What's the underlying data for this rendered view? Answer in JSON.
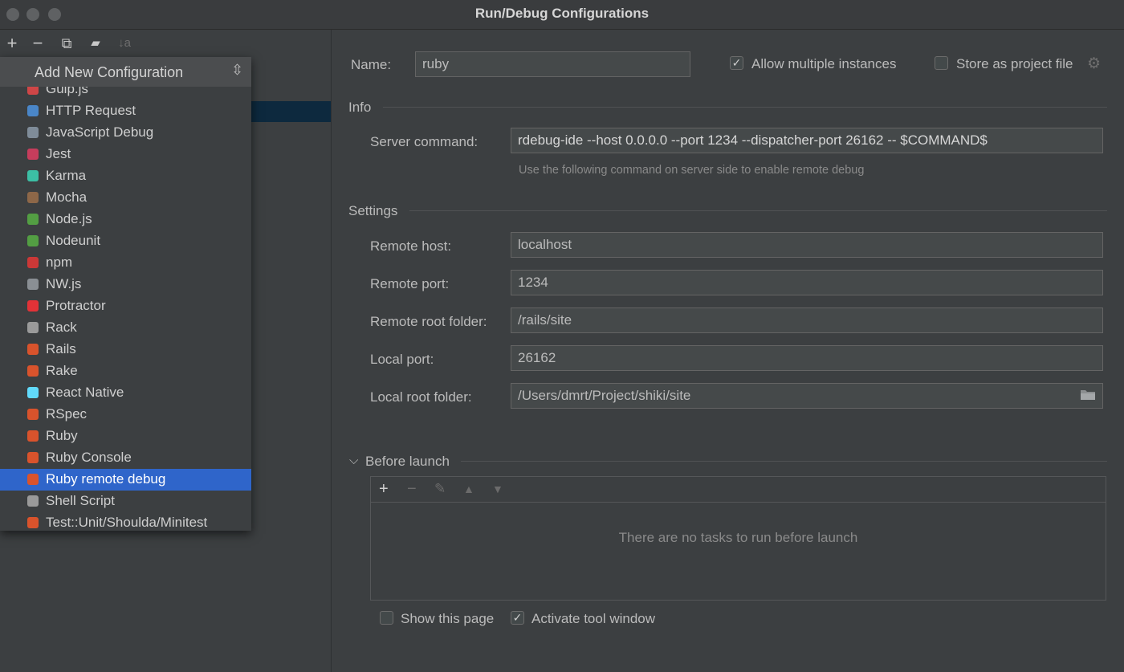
{
  "window": {
    "title": "Run/Debug Configurations"
  },
  "left_toolbar": {
    "add": "+",
    "remove": "−",
    "copy": "⧉",
    "folder": "▰",
    "sort": "↓a"
  },
  "popup": {
    "title": "Add New Configuration",
    "items": [
      {
        "label": "Gulp.js",
        "icon": "gulp-icon",
        "color": "#cf4647"
      },
      {
        "label": "HTTP Request",
        "icon": "api-icon",
        "color": "#4a86c8"
      },
      {
        "label": "JavaScript Debug",
        "icon": "js-debug-icon",
        "color": "#7f8c99"
      },
      {
        "label": "Jest",
        "icon": "jest-icon",
        "color": "#c63d5c"
      },
      {
        "label": "Karma",
        "icon": "karma-icon",
        "color": "#3cbfa5"
      },
      {
        "label": "Mocha",
        "icon": "mocha-icon",
        "color": "#8d6748"
      },
      {
        "label": "Node.js",
        "icon": "nodejs-icon",
        "color": "#539e43"
      },
      {
        "label": "Nodeunit",
        "icon": "nodeunit-icon",
        "color": "#539e43"
      },
      {
        "label": "npm",
        "icon": "npm-icon",
        "color": "#cb3837"
      },
      {
        "label": "NW.js",
        "icon": "nwjs-icon",
        "color": "#8a8f94"
      },
      {
        "label": "Protractor",
        "icon": "protractor-icon",
        "color": "#e23237"
      },
      {
        "label": "Rack",
        "icon": "rack-icon",
        "color": "#9a9a9a"
      },
      {
        "label": "Rails",
        "icon": "rails-icon",
        "color": "#d9532c"
      },
      {
        "label": "Rake",
        "icon": "rake-icon",
        "color": "#d9532c"
      },
      {
        "label": "React Native",
        "icon": "react-icon",
        "color": "#61dafb"
      },
      {
        "label": "RSpec",
        "icon": "rspec-icon",
        "color": "#d9532c"
      },
      {
        "label": "Ruby",
        "icon": "ruby-icon",
        "color": "#d9532c"
      },
      {
        "label": "Ruby Console",
        "icon": "ruby-console-icon",
        "color": "#d9532c"
      },
      {
        "label": "Ruby remote debug",
        "icon": "ruby-remote-debug-icon",
        "color": "#d9532c",
        "selected": true
      },
      {
        "label": "Shell Script",
        "icon": "shell-script-icon",
        "color": "#9a9a9a"
      },
      {
        "label": "Test::Unit/Shoulda/Minitest",
        "icon": "test-unit-icon",
        "color": "#d9532c"
      }
    ]
  },
  "form": {
    "name_label": "Name:",
    "name_value": "ruby",
    "allow_multiple": "Allow multiple instances",
    "allow_multiple_checked": "✓",
    "store_project": "Store as project file",
    "info_section": "Info",
    "server_command_label": "Server command:",
    "server_command_value": "rdebug-ide --host 0.0.0.0 --port 1234 --dispatcher-port 26162 -- $COMMAND$",
    "server_command_hint": "Use the following command on server side to enable remote debug",
    "settings_section": "Settings",
    "remote_host_label": "Remote host:",
    "remote_host_value": "localhost",
    "remote_port_label": "Remote port:",
    "remote_port_value": "1234",
    "remote_root_label": "Remote root folder:",
    "remote_root_value": "/rails/site",
    "local_port_label": "Local port:",
    "local_port_value": "26162",
    "local_root_label": "Local root folder:",
    "local_root_value": "/Users/dmrt/Project/shiki/site"
  },
  "before_launch": {
    "title": "Before launch",
    "empty_text": "There are no tasks to run before launch",
    "show_page": "Show this page",
    "activate_tool": "Activate tool window",
    "activate_checked": "✓"
  }
}
